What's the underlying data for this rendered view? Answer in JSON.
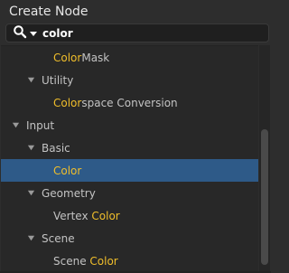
{
  "window": {
    "title": "Create Node"
  },
  "search": {
    "value": "color"
  },
  "colors": {
    "highlight": "#f0be2b",
    "selection": "#2e5a88"
  },
  "tree": [
    {
      "pre": "",
      "match": "Color",
      "post": " Mask",
      "expanded": null
    },
    {
      "pre": "Utility",
      "match": "",
      "post": "",
      "expanded": true
    },
    {
      "pre": "",
      "match": "Color",
      "post": "space Conversion",
      "expanded": null
    },
    {
      "pre": "Input",
      "match": "",
      "post": "",
      "expanded": true
    },
    {
      "pre": "Basic",
      "match": "",
      "post": "",
      "expanded": true
    },
    {
      "pre": "",
      "match": "Color",
      "post": "",
      "expanded": null,
      "selected": true
    },
    {
      "pre": "Geometry",
      "match": "",
      "post": "",
      "expanded": true
    },
    {
      "pre": "Vertex ",
      "match": "Color",
      "post": "",
      "expanded": null
    },
    {
      "pre": "Scene",
      "match": "",
      "post": "",
      "expanded": true
    },
    {
      "pre": "Scene ",
      "match": "Color",
      "post": "",
      "expanded": null
    }
  ]
}
